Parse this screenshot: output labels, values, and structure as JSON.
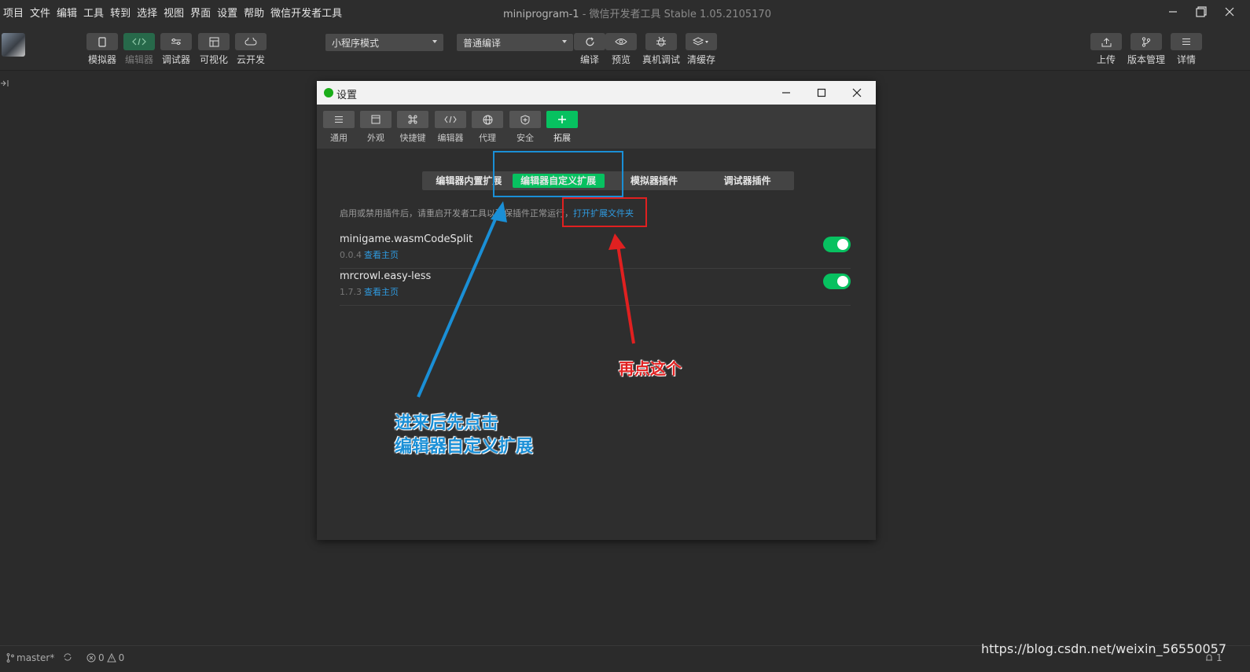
{
  "menubar": {
    "items": [
      "项目",
      "文件",
      "编辑",
      "工具",
      "转到",
      "选择",
      "视图",
      "界面",
      "设置",
      "帮助",
      "微信开发者工具"
    ],
    "title": "miniprogram-1",
    "title_sub": " - 微信开发者工具 Stable 1.05.2105170"
  },
  "toolbar": {
    "left_buttons": [
      {
        "label": "模拟器",
        "icon": "phone-icon"
      },
      {
        "label": "编辑器",
        "icon": "code-icon"
      },
      {
        "label": "调试器",
        "icon": "debug-icon"
      },
      {
        "label": "可视化",
        "icon": "layout-icon"
      },
      {
        "label": "云开发",
        "icon": "cloud-icon"
      }
    ],
    "mode_select": "小程序模式",
    "compile_select": "普通编译",
    "mid_buttons": [
      {
        "label": "编译",
        "icon": "refresh-icon"
      },
      {
        "label": "预览",
        "icon": "eye-icon"
      },
      {
        "label": "真机调试",
        "icon": "bug-icon"
      },
      {
        "label": "清缓存",
        "icon": "layers-icon"
      }
    ],
    "right_buttons": [
      {
        "label": "上传",
        "icon": "upload-icon"
      },
      {
        "label": "版本管理",
        "icon": "branch-icon"
      },
      {
        "label": "详情",
        "icon": "menu-icon"
      }
    ]
  },
  "dialog": {
    "title": "设置",
    "tabs": [
      {
        "label": "通用",
        "icon": "list-icon"
      },
      {
        "label": "外观",
        "icon": "window-icon"
      },
      {
        "label": "快捷键",
        "icon": "command-icon"
      },
      {
        "label": "编辑器",
        "icon": "code-icon"
      },
      {
        "label": "代理",
        "icon": "globe-icon"
      },
      {
        "label": "安全",
        "icon": "shield-icon"
      },
      {
        "label": "拓展",
        "icon": "plus-icon"
      }
    ],
    "segments": [
      "编辑器内置扩展",
      "编辑器自定义扩展",
      "模拟器插件",
      "调试器插件"
    ],
    "active_segment": "编辑器自定义扩展",
    "hint": "启用或禁用插件后，请重启开发者工具以确保插件正常运行，",
    "hint_link": "打开扩展文件夹",
    "extensions": [
      {
        "name": "minigame.wasmCodeSplit",
        "version": "0.0.4",
        "home": "查看主页",
        "enabled": true
      },
      {
        "name": "mrcrowl.easy-less",
        "version": "1.7.3",
        "home": "查看主页",
        "enabled": true
      }
    ]
  },
  "annotations": {
    "blue_line1": "进来后先点击",
    "blue_line2": "编辑器自定义扩展",
    "red": "再点这个",
    "blue_color": "#1a8fd6",
    "red_color": "#e02020"
  },
  "statusbar": {
    "branch": "master*",
    "errors": "0",
    "warnings": "0",
    "notify": "1"
  },
  "watermark": "https://blog.csdn.net/weixin_56550057"
}
